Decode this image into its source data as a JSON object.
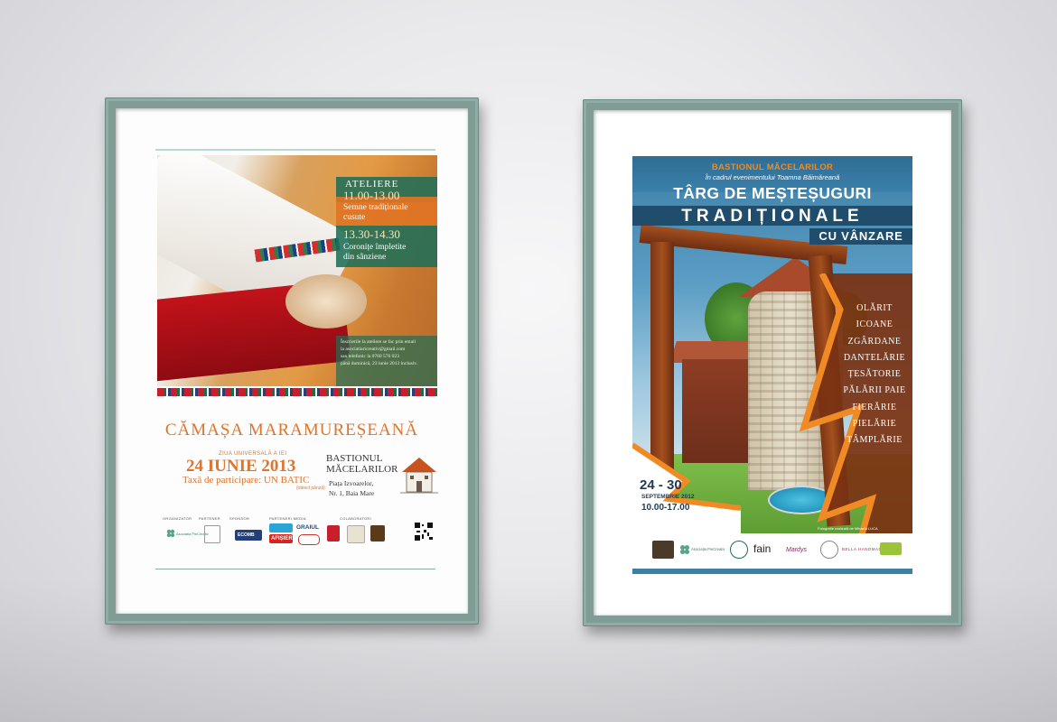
{
  "poster1": {
    "workshops_label": "ATELIERE",
    "slot1_time": "11.00-13.00",
    "slot1_title_line1": "Semne tradiționale",
    "slot1_title_line2": "cusute",
    "slot2_time": "13.30-14.30",
    "slot2_title_line1": "Coronițe împletite",
    "slot2_title_line2": "din sânziene",
    "signup_line1": "Înscrierile la ateliere se fac prin email",
    "signup_line2": "la asociatiaricreativ@gmail.com",
    "signup_line3": "sau telefonic la 0760 576 023",
    "signup_line4": "până duminică, 23 iunie 2013 inclusiv.",
    "title": "CĂMAȘA MARAMUREȘEANĂ",
    "day_label": "ZIUA UNIVERSALĂ A IEI",
    "date": "24 IUNIE 2013",
    "fee": "Taxă de participare: UN BATIC",
    "fee_note": "(obiect pânză)",
    "venue_line1": "BASTIONUL",
    "venue_line2": "MĂCELARILOR",
    "address_line1": "Piața Izvoarelor,",
    "address_line2": "Nr. 1, Baia Mare",
    "sponsor_labels": [
      "ORGANIZATOR",
      "PARTENER",
      "SPONSOR",
      "PARTENERI MEDIA",
      "COLABORATORI"
    ],
    "logos": {
      "organizer": "Asociatia PieCreativ",
      "media1": "AFIȘIER",
      "media2": "GRAIUL",
      "sponsor": "ECOMB"
    }
  },
  "poster2": {
    "header": "BASTIONUL MĂCELARILOR",
    "context": "În cadrul evenimentului Toamna Băimăreană",
    "title_line1": "TÂRG DE MEȘTEȘUGURI",
    "title_line2": "TRADIȚIONALE",
    "title_line3": "CU VÂNZARE",
    "crafts": [
      "OLĂRIT",
      "ICOANE",
      "ZGÂRDANE",
      "DANTELĂRIE",
      "ȚESĂTORIE",
      "PĂLĂRII PAIE",
      "FIERĂRIE",
      "PIELĂRIE",
      "TÂMPLĂRIE"
    ],
    "dates": "24 - 30",
    "month": "SEPTEMBRIE 2012",
    "hours": "10.00-17.00",
    "photo_credit": "Fotografie realizată de Mihaela LUCA",
    "logos": {
      "organizer": "Asociația PieCreativ",
      "fain": "fain",
      "mardys": "Mardys",
      "bella": "BELLA HANDMADE"
    }
  },
  "colors": {
    "frame": "#7f9c95",
    "poster1_accent": "#e0742a",
    "poster1_green": "#1f6e56",
    "poster2_blue": "#3e7fa6",
    "poster2_orange": "#f08a24",
    "poster2_navy": "#1f4d6b"
  }
}
